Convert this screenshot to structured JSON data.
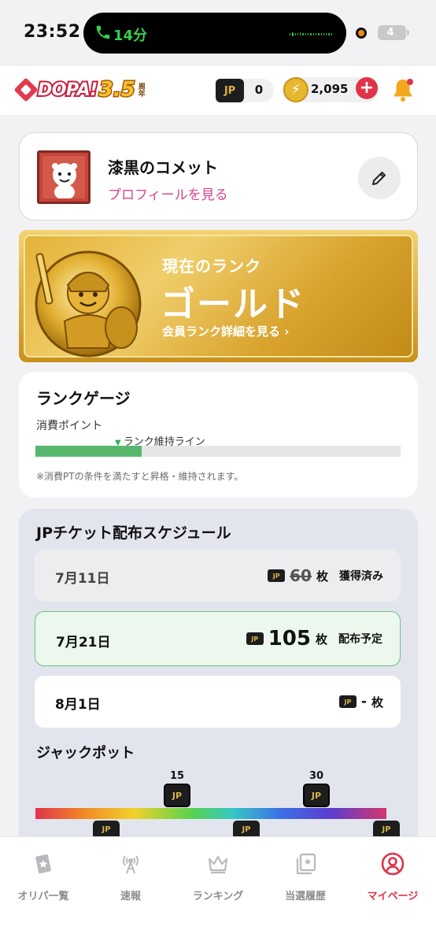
{
  "status_bar": {
    "time": "23:52",
    "call_duration": "14分",
    "battery": "4"
  },
  "header": {
    "logo_text": "DOPA!",
    "logo_anniversary": "3.5",
    "logo_anniversary_suffix": "周年",
    "jp_label": "JP",
    "jp_count": "0",
    "coin_count": "2,095",
    "plus_label": "+"
  },
  "profile": {
    "name": "漆黒のコメット",
    "link": "プロフィールを見る"
  },
  "rank": {
    "label": "現在のランク",
    "value": "ゴールド",
    "link": "会員ランク詳細を見る ›"
  },
  "gauge": {
    "title": "ランクゲージ",
    "subtitle": "消費ポイント",
    "marker_label": "ランク維持ライン",
    "fill_fraction": 0.29,
    "note": "※消費PTの条件を満たすと昇格・維持されます。"
  },
  "schedule": {
    "title": "JPチケット配布スケジュール",
    "rows": [
      {
        "date": "7月11日",
        "qty": "60",
        "unit": "枚",
        "status": "獲得済み"
      },
      {
        "date": "7月21日",
        "qty": "105",
        "unit": "枚",
        "status": "配布予定"
      },
      {
        "date": "8月1日",
        "qty": "-",
        "unit": "枚",
        "status": ""
      }
    ]
  },
  "jackpot": {
    "title": "ジャックポット",
    "milestones": [
      "15",
      "30"
    ]
  },
  "tabs": [
    {
      "label": "オリパ一覧",
      "icon": "card-star-icon"
    },
    {
      "label": "速報",
      "icon": "broadcast-icon"
    },
    {
      "label": "ランキング",
      "icon": "crown-icon"
    },
    {
      "label": "当選履歴",
      "icon": "history-star-icon"
    },
    {
      "label": "マイページ",
      "icon": "user-circle-icon"
    }
  ],
  "colors": {
    "accent": "#e0334a",
    "profile_link": "#d6458a",
    "gauge_fill": "#57b86d",
    "gold": "#d8a22c"
  }
}
